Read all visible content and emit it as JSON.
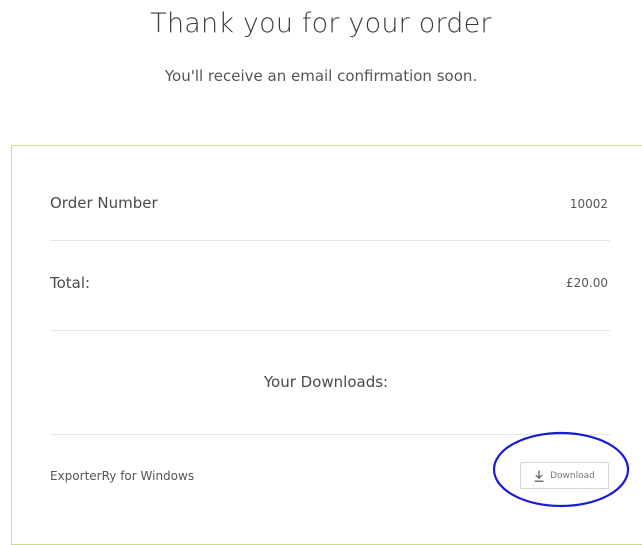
{
  "header": {
    "title": "Thank you for your order",
    "subtitle": "You'll receive an email confirmation soon."
  },
  "order": {
    "number_label": "Order Number",
    "number_value": "10002",
    "total_label": "Total:",
    "total_value": "£20.00"
  },
  "downloads": {
    "heading": "Your Downloads:",
    "items": [
      {
        "name": "ExporterRy for Windows",
        "button_label": "Download",
        "button_icon": "download-arrow-icon"
      }
    ]
  },
  "annotation": {
    "highlight_color": "#1a1ad6",
    "accent_border_color": "#c9dc86"
  }
}
